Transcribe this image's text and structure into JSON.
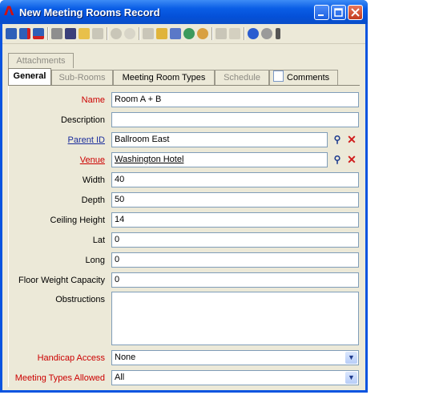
{
  "window": {
    "title": "New Meeting Rooms Record"
  },
  "toolbar": {
    "icons": [
      "save-icon",
      "save-new-icon",
      "save-close-icon",
      "print-icon",
      "find-icon",
      "open-folder-icon",
      "list-icon",
      "forward-icon",
      "delete-icon",
      "copy-icon",
      "report-icon",
      "merge-icon",
      "refresh-icon",
      "settings-icon",
      "link-icon",
      "note-icon",
      "help-icon",
      "info-icon"
    ]
  },
  "tabs": {
    "row1": [
      {
        "label": "Attachments",
        "disabled": true
      }
    ],
    "row2": [
      {
        "label": "General",
        "active": true
      },
      {
        "label": "Sub-Rooms",
        "disabled": true
      },
      {
        "label": "Meeting Room Types"
      },
      {
        "label": "Schedule",
        "disabled": true
      },
      {
        "label": "Comments"
      }
    ]
  },
  "form": {
    "name": {
      "label": "Name",
      "value": "Room A + B"
    },
    "description": {
      "label": "Description",
      "value": ""
    },
    "parent_id": {
      "label": "Parent ID",
      "value": "Ballroom East"
    },
    "venue": {
      "label": "Venue",
      "value": "Washington Hotel"
    },
    "width": {
      "label": "Width",
      "value": "40"
    },
    "depth": {
      "label": "Depth",
      "value": "50"
    },
    "ceiling_height": {
      "label": "Ceiling Height",
      "value": "14"
    },
    "lat": {
      "label": "Lat",
      "value": "0"
    },
    "long": {
      "label": "Long",
      "value": "0"
    },
    "floor_weight": {
      "label": "Floor Weight Capacity",
      "value": "0"
    },
    "obstructions": {
      "label": "Obstructions",
      "value": ""
    },
    "handicap_access": {
      "label": "Handicap Access",
      "value": "None"
    },
    "meeting_types_allowed": {
      "label": "Meeting Types Allowed",
      "value": "All"
    }
  },
  "colors": {
    "required_label": "#cc0000",
    "link_label": "#1a2d9c",
    "title_bar": "#0a5ee6"
  }
}
